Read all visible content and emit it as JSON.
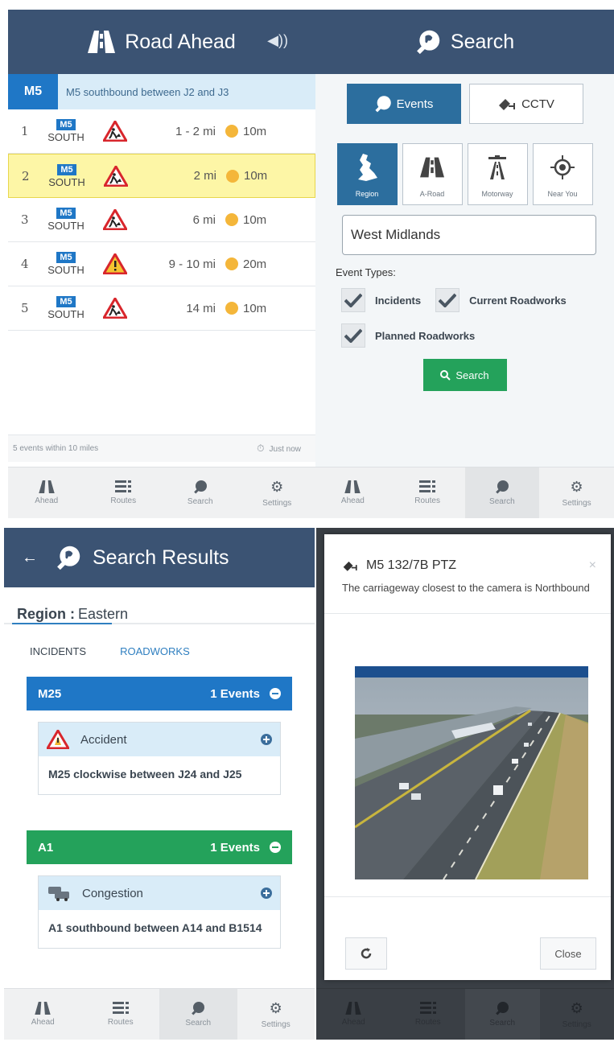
{
  "road_ahead": {
    "title": "Road Ahead",
    "route_code": "M5",
    "route_desc": "M5 southbound between J2 and J3",
    "events": [
      {
        "num": "1",
        "road": "M5",
        "dir": "SOUTH",
        "dist": "1 - 2 mi",
        "time": "10m",
        "sign": "roadworks",
        "selected": false
      },
      {
        "num": "2",
        "road": "M5",
        "dir": "SOUTH",
        "dist": "2 mi",
        "time": "10m",
        "sign": "roadworks",
        "selected": true
      },
      {
        "num": "3",
        "road": "M5",
        "dir": "SOUTH",
        "dist": "6 mi",
        "time": "10m",
        "sign": "roadworks",
        "selected": false
      },
      {
        "num": "4",
        "road": "M5",
        "dir": "SOUTH",
        "dist": "9 - 10 mi",
        "time": "20m",
        "sign": "warning",
        "selected": false
      },
      {
        "num": "5",
        "road": "M5",
        "dir": "SOUTH",
        "dist": "14 mi",
        "time": "10m",
        "sign": "roadworks",
        "selected": false
      }
    ],
    "footer_left": "5 events within 10 miles",
    "footer_right": "Just now"
  },
  "tabs": {
    "ahead": "Ahead",
    "routes": "Routes",
    "search": "Search",
    "settings": "Settings"
  },
  "search": {
    "title": "Search",
    "mode_events": "Events",
    "mode_cctv": "CCTV",
    "type_region": "Region",
    "type_aroad": "A-Road",
    "type_motorway": "Motorway",
    "type_near": "Near You",
    "region_value": "West Midlands",
    "event_types_label": "Event Types:",
    "chk_incidents": "Incidents",
    "chk_current": "Current Roadworks",
    "chk_planned": "Planned Roadworks",
    "button": "Search"
  },
  "results": {
    "title": "Search Results",
    "region_label": "Region :",
    "region_value": "Eastern",
    "tab_incidents": "INCIDENTS",
    "tab_roadworks": "ROADWORKS",
    "groups": [
      {
        "road": "M25",
        "count": "1 Events",
        "event_type": "Accident",
        "desc": "M25 clockwise between J24 and J25"
      },
      {
        "road": "A1",
        "count": "1 Events",
        "event_type": "Congestion",
        "desc": "A1 southbound between A14 and B1514"
      }
    ]
  },
  "cctv": {
    "title": "M5 132/7B PTZ",
    "desc": "The carriageway closest to the camera is Northbound",
    "close_label": "Close",
    "close_x": "×"
  },
  "colors": {
    "header": "#3b5373",
    "motorway_blue": "#1f77c6",
    "aroad_green": "#24a25b",
    "selected_row": "#fdf6a6"
  }
}
